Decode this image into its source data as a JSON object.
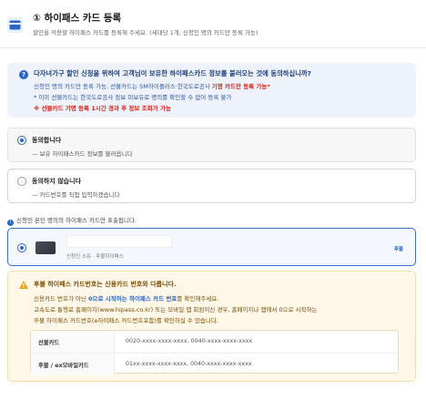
{
  "header": {
    "title": "① 하이패스 카드 등록",
    "subtitle": "할인을 적용할 하이패스 카드를 등록해 주세요. (세대당 1개, 신청인 명의 카드만 등록 가능)"
  },
  "notice": {
    "icon_text": "?",
    "title": "다자녀가구 할인 신청을 위하여 고객님이 보유한 하이패스카드 정보를 불러오는 것에 동의하십니까?",
    "line1_pre": "신청인 명의 카드만 등록 가능, 선불카드는 SM하이플러스·한국도로공사 ",
    "line1_red": "기명 카드만 등록 가능*",
    "line2": "* 이미 선불카드는 한국도로공사 정보 미보유로 명의를 확인할 수 없어 등록 불가",
    "line3": "※ 선불카드 기명 등록 1시간 경과 후 정보 조회가 가능"
  },
  "options": {
    "agree": {
      "title": "동의합니다",
      "sub": "— 보유 하이패스카드 정보를 불러옵니다",
      "selected": true
    },
    "disagree": {
      "title": "동의하지 않습니다",
      "sub": "— 카드번호를 직접 입력하겠습니다",
      "selected": false
    }
  },
  "info": {
    "icon_text": "i",
    "text": "신청인 본인 명의의 하이패스 카드만 표출됩니다."
  },
  "card": {
    "meta": "신청인 소유 · 후불하이패스",
    "badge": "후불",
    "selected": true
  },
  "warning": {
    "title": "후불 하이패스 카드번호는 신용카드 번호와 다릅니다.",
    "line1_pre": "신용카드 번호가 아닌 ",
    "line1_hl": "0으로 시작하는 하이패스 카드 번호",
    "line1_post": "를 확인해주세요.",
    "line2": "고속도로 통행료 홈페이지(www.hipass.co.kr) 또는 모바일 앱 회원이신 경우, 홈페이지나 앱에서 0으로 시작하는",
    "line3": "후불 하이패스 카드번호(e하이패스 카드번호포함)를 확인하실 수 있습니다.",
    "table": [
      {
        "label": "선불카드",
        "value": "0020-xxxx-xxxx-xxxx, 0040-xxxx-xxxx-xxxx"
      },
      {
        "label": "후불 / ex모바일카드",
        "value": "01xx-xxxx-xxxx-xxxx, 0040-xxxx-xxxx-xxxx"
      }
    ]
  },
  "colors": {
    "accent": "#2b64c8",
    "alert": "#d7261e",
    "warning_bg": "#fff8e8"
  }
}
